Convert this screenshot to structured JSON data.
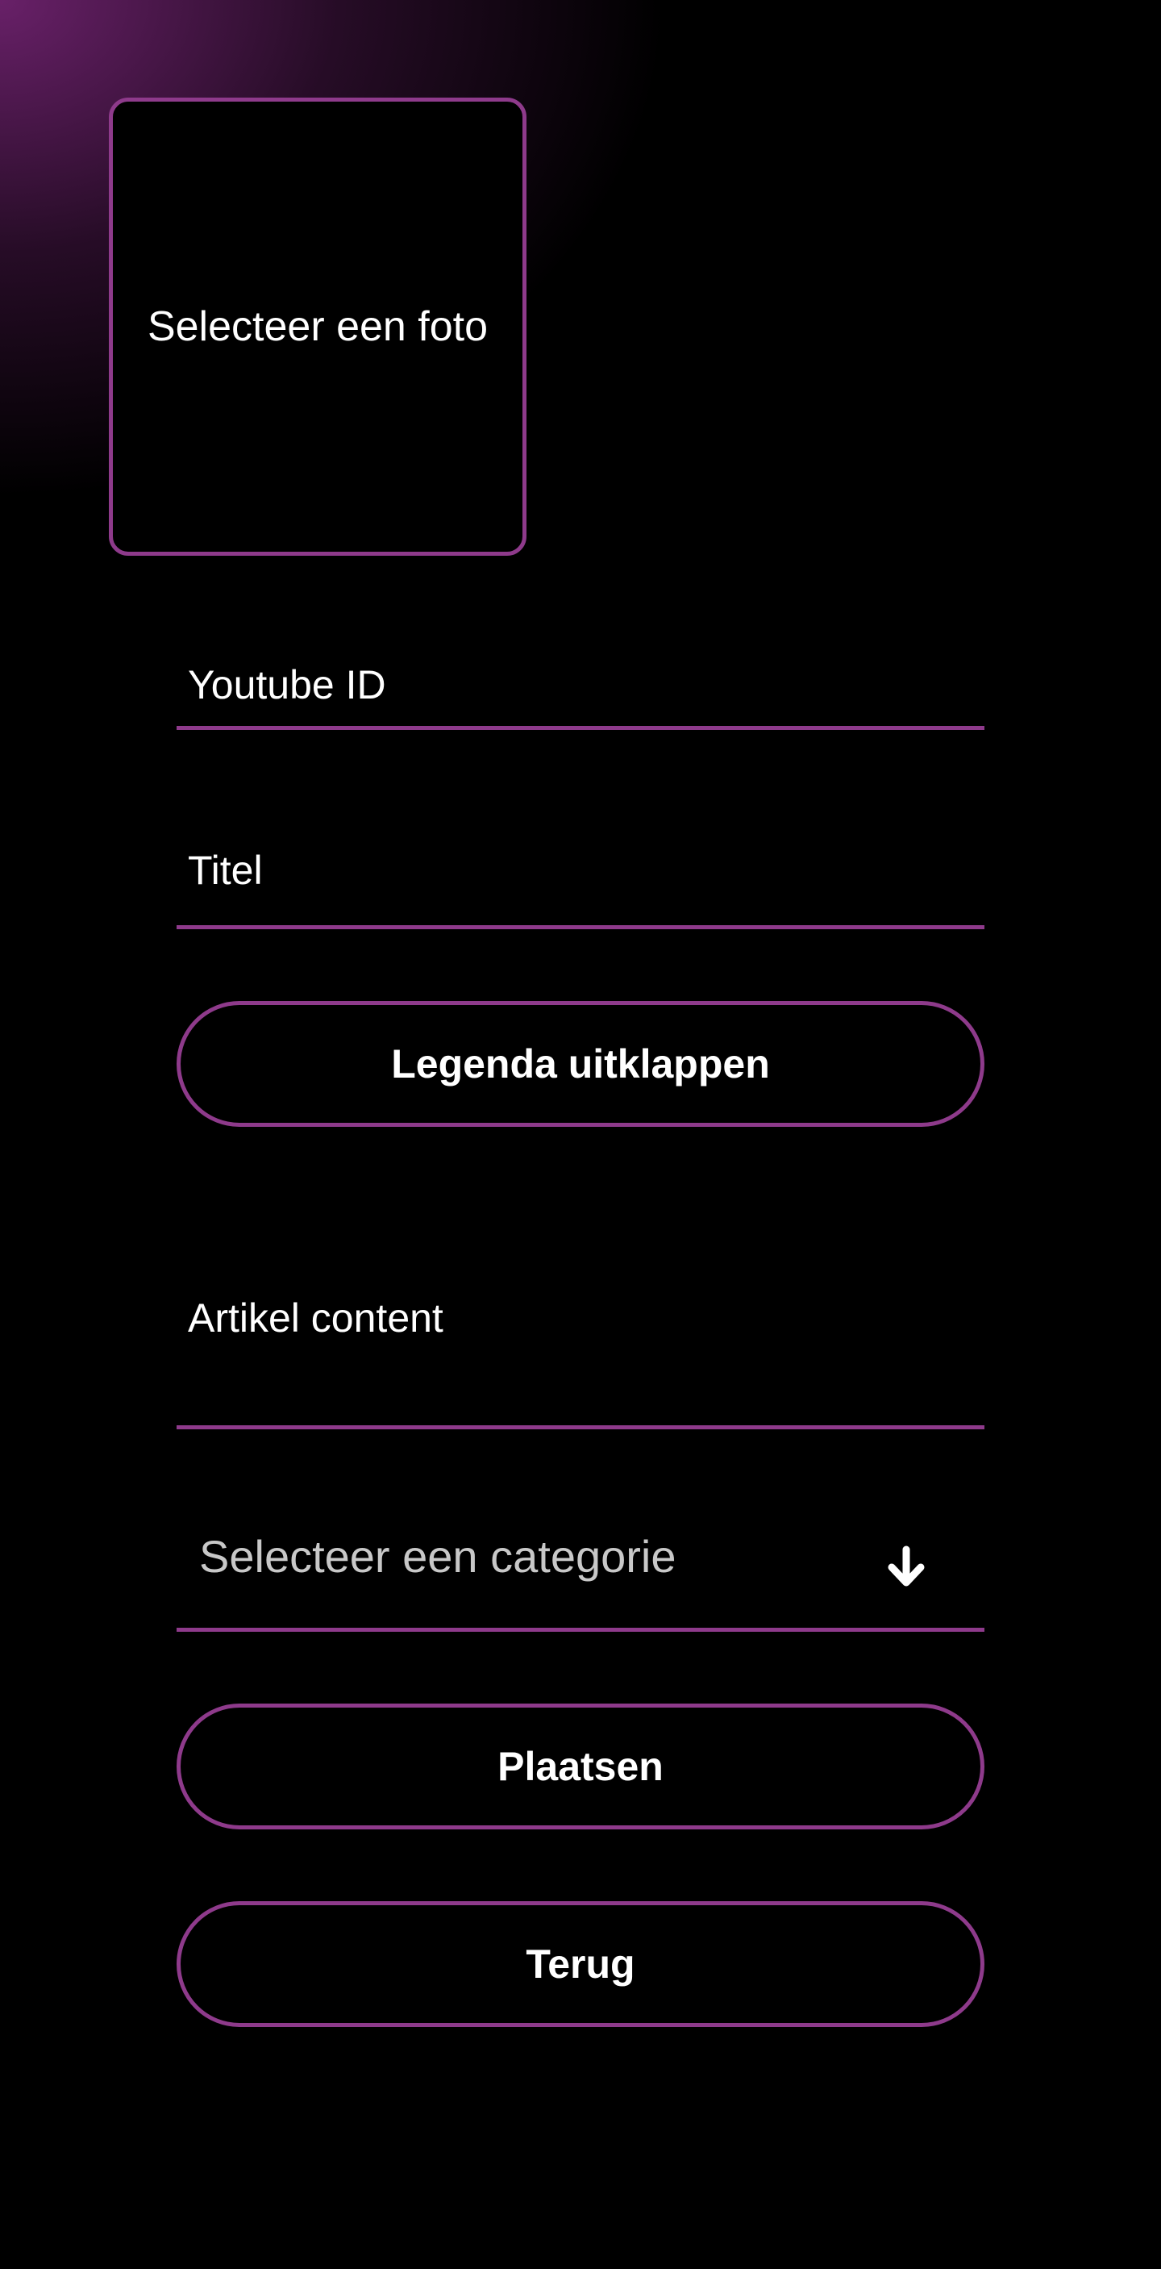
{
  "colors": {
    "accent": "#8e3a8b",
    "background": "#000000",
    "glow": "#6e226e",
    "text": "#ffffff",
    "placeholder": "#c8c8c8"
  },
  "photo": {
    "label": "Selecteer een foto"
  },
  "form": {
    "youtube_label": "Youtube ID",
    "title_label": "Titel",
    "legend_button": "Legenda uitklappen",
    "content_label": "Artikel content",
    "category": {
      "selected": "Selecteer een categorie",
      "icon": "arrow-down-icon"
    },
    "post_button": "Plaatsen",
    "back_button": "Terug"
  }
}
